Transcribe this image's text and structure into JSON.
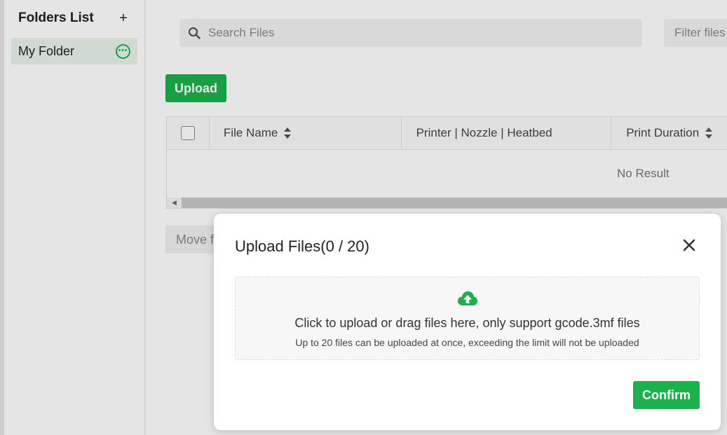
{
  "sidebar": {
    "title": "Folders List",
    "add_label": "+",
    "folders": [
      {
        "label": "My Folder",
        "icon": "more-options-icon"
      }
    ]
  },
  "search": {
    "placeholder": "Search Files",
    "icon": "search-icon"
  },
  "filter": {
    "label": "Filter files"
  },
  "toolbar": {
    "upload_label": "Upload",
    "move_label": "Move files"
  },
  "table": {
    "columns": [
      "File Name",
      "Printer | Nozzle | Heatbed",
      "Print Duration"
    ],
    "empty_text": "No Result",
    "scroll_left_label": "◀"
  },
  "modal": {
    "title": "Upload Files(0 / 20)",
    "close_label": "✕",
    "dropzone_main": "Click to upload or drag files here, only support gcode.3mf files",
    "dropzone_sub": "Up to 20 files can be uploaded at once, exceeding the limit will not be uploaded",
    "confirm_label": "Confirm"
  },
  "colors": {
    "accent": "#1bb14c",
    "selected_folder_bg": "#e9f3ea",
    "overlay": "rgba(0,0,0,0.1)"
  }
}
